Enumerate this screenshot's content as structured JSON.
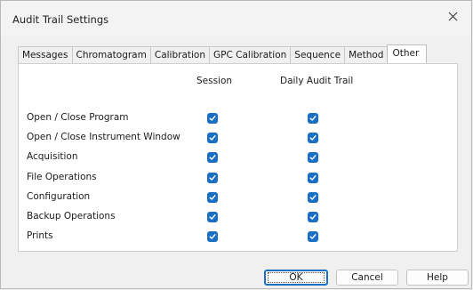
{
  "window": {
    "title": "Audit Trail Settings"
  },
  "tabs": [
    {
      "label": "Messages",
      "active": false
    },
    {
      "label": "Chromatogram",
      "active": false
    },
    {
      "label": "Calibration",
      "active": false
    },
    {
      "label": "GPC Calibration",
      "active": false
    },
    {
      "label": "Sequence",
      "active": false
    },
    {
      "label": "Method",
      "active": false
    },
    {
      "label": "Other",
      "active": true
    }
  ],
  "columns": {
    "session": "Session",
    "daily": "Daily Audit Trail"
  },
  "rows": [
    {
      "label": "Open / Close Program",
      "session": true,
      "daily": true
    },
    {
      "label": "Open / Close Instrument Window",
      "session": true,
      "daily": true
    },
    {
      "label": "Acquisition",
      "session": true,
      "daily": true
    },
    {
      "label": "File Operations",
      "session": true,
      "daily": true
    },
    {
      "label": "Configuration",
      "session": true,
      "daily": true
    },
    {
      "label": "Backup Operations",
      "session": true,
      "daily": true
    },
    {
      "label": "Prints",
      "session": true,
      "daily": true
    }
  ],
  "buttons": {
    "ok": "OK",
    "cancel": "Cancel",
    "help": "Help"
  },
  "colors": {
    "accent": "#1a6fc4",
    "panel": "#ffffff",
    "window": "#f0f0f0"
  }
}
